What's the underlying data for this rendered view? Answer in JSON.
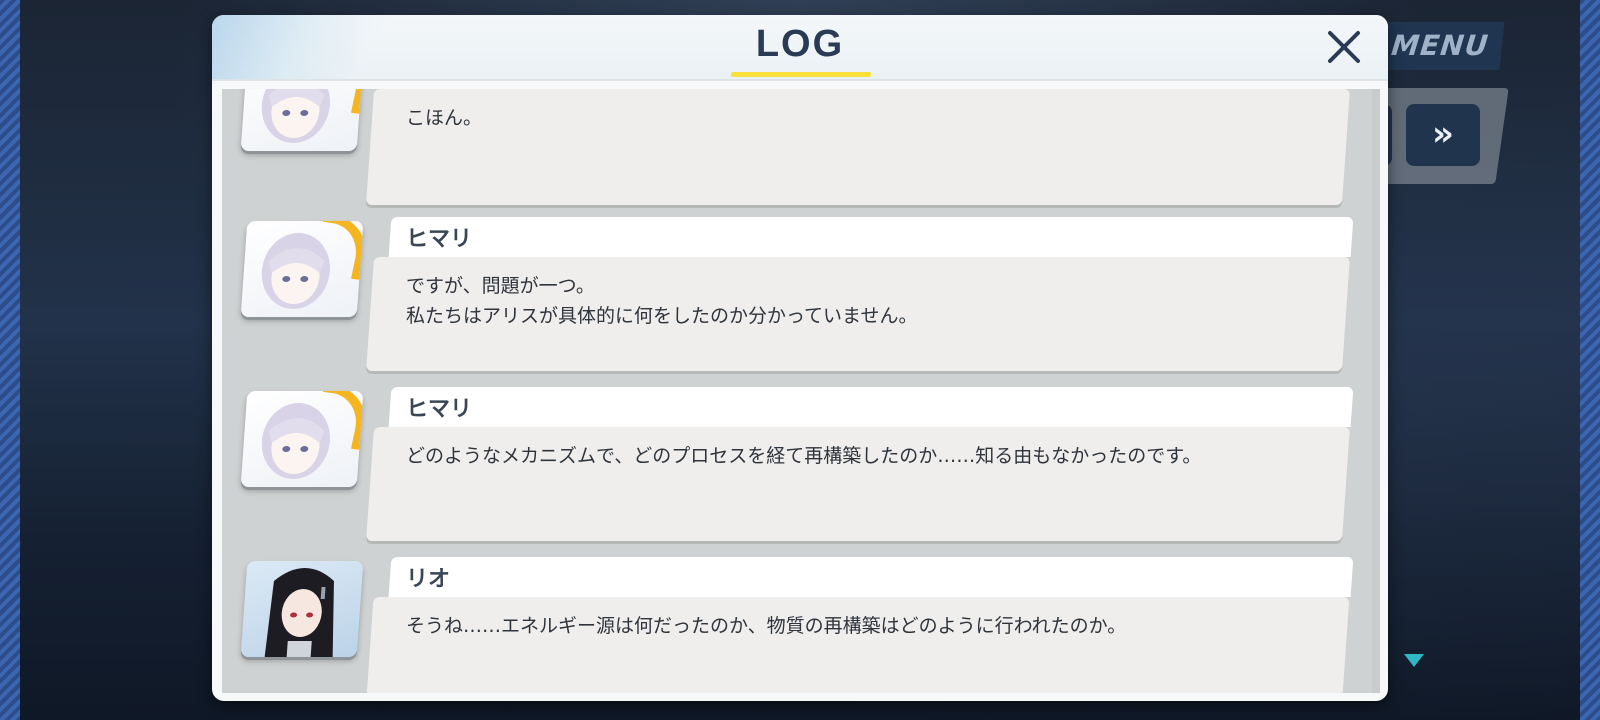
{
  "background": {
    "menu_label": "MENU",
    "fast_forward_icon": "»"
  },
  "log": {
    "title": "LOG",
    "close_icon": "close-icon",
    "accent_color": "#f7e13a",
    "entries": [
      {
        "speaker": "",
        "avatar": "himari",
        "text": "こほん。"
      },
      {
        "speaker": "ヒマリ",
        "avatar": "himari",
        "text": "ですが、問題が一つ。\n私たちはアリスが具体的に何をしたのか分かっていません。"
      },
      {
        "speaker": "ヒマリ",
        "avatar": "himari",
        "text": "どのようなメカニズムで、どのプロセスを経て再構築したのか……知る由もなかったのです。"
      },
      {
        "speaker": "リオ",
        "avatar": "rio",
        "text": "そうね……エネルギー源は何だったのか、物質の再構築はどのように行われたのか。"
      }
    ]
  }
}
